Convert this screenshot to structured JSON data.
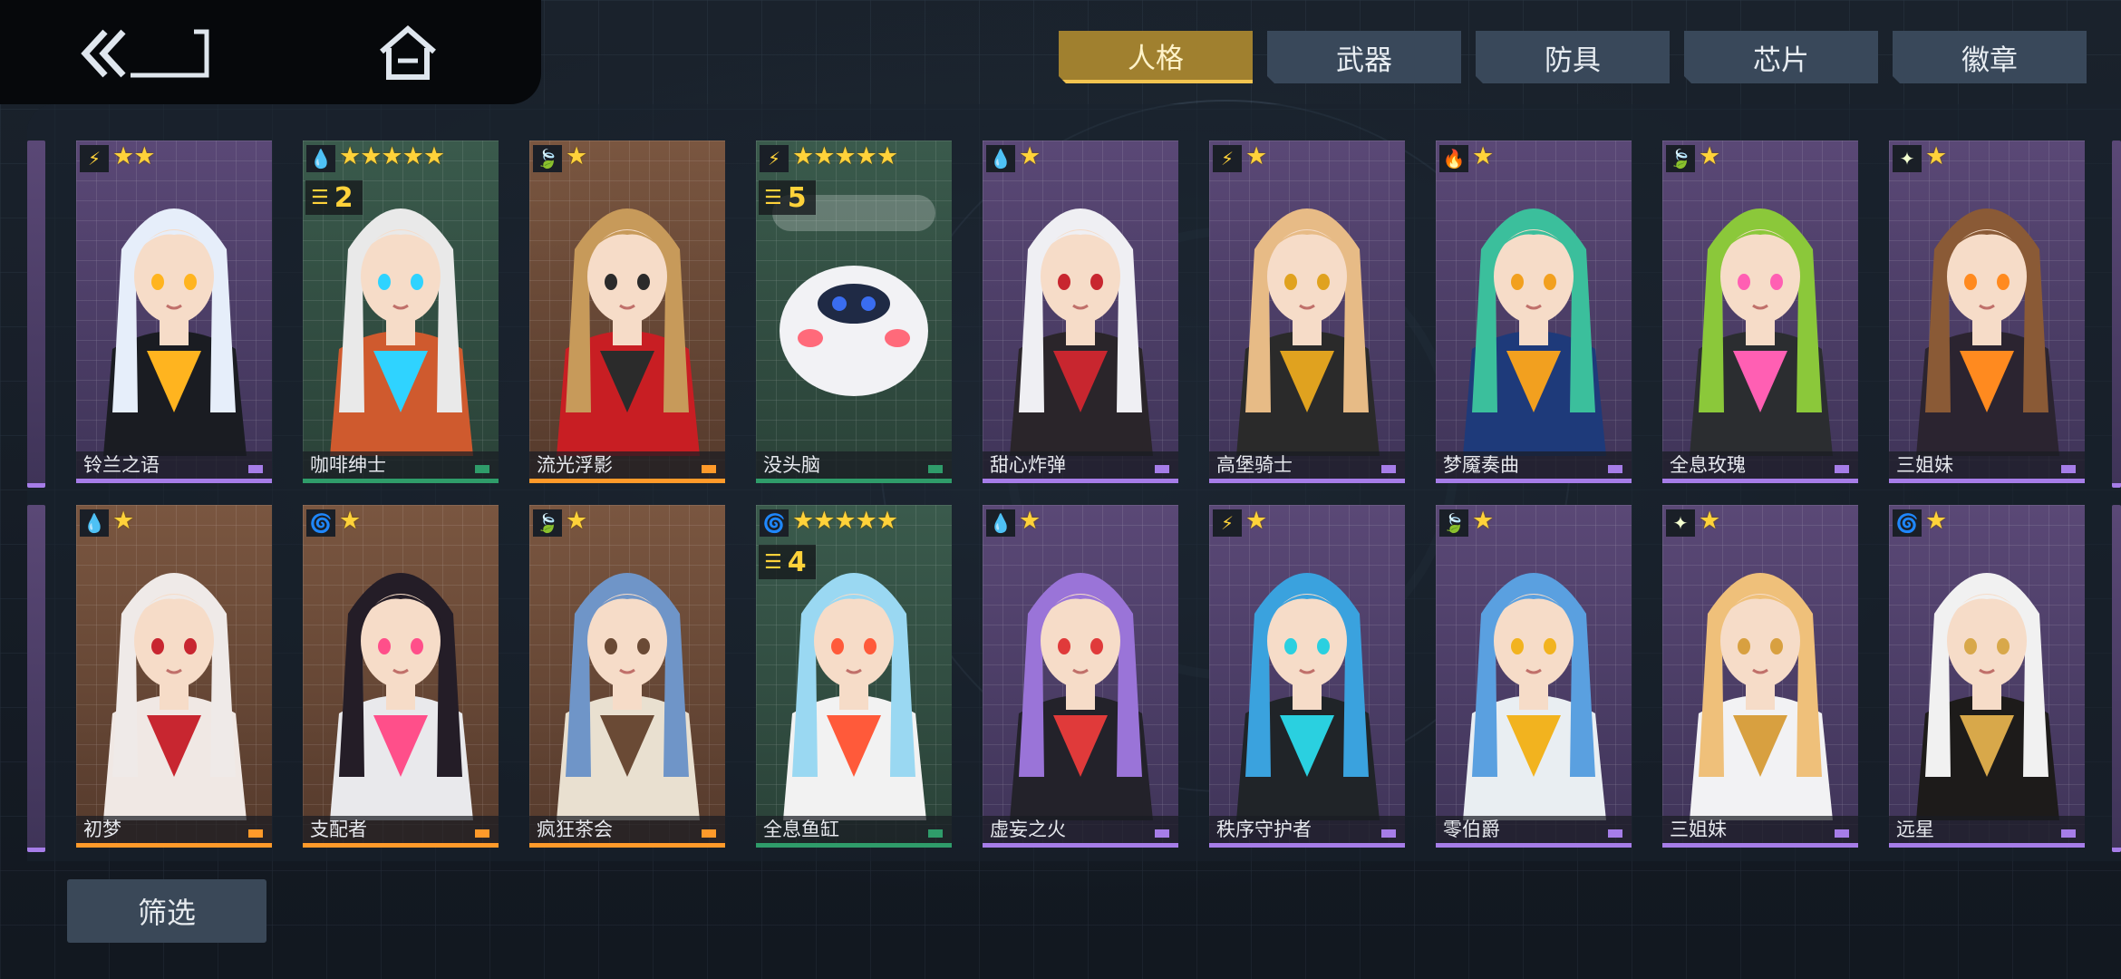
{
  "nav": {
    "back_icon": "double-chevron-back-icon",
    "home_icon": "home-icon"
  },
  "tabs": [
    {
      "label": "人格",
      "active": true
    },
    {
      "label": "武器",
      "active": false
    },
    {
      "label": "防具",
      "active": false
    },
    {
      "label": "芯片",
      "active": false
    },
    {
      "label": "徽章",
      "active": false
    }
  ],
  "element_icons": {
    "electric": {
      "glyph": "⚡",
      "color": "#ffd23a"
    },
    "water": {
      "glyph": "💧",
      "color": "#4fb3ff"
    },
    "wind": {
      "glyph": "🍃",
      "color": "#3cc26a"
    },
    "fire": {
      "glyph": "🔥",
      "color": "#ff5a2a"
    },
    "light": {
      "glyph": "✦",
      "color": "#f3ffd0"
    },
    "vortex": {
      "glyph": "🌀",
      "color": "#c86cff"
    }
  },
  "cards_row1": [
    {
      "name": "铃兰之语",
      "element": "electric",
      "stars": "★★",
      "level": "",
      "rarity": "purple",
      "hair": "#e6eefa",
      "outfit": "#1a1c22",
      "accent": "#ffb41f"
    },
    {
      "name": "咖啡绅士",
      "element": "water",
      "stars": "★★★★★",
      "level": "2",
      "rarity": "green",
      "hair": "#e9e9e9",
      "outfit": "#cf5a2e",
      "accent": "#2fd3ff"
    },
    {
      "name": "流光浮影",
      "element": "wind",
      "stars": "★",
      "level": "",
      "rarity": "orange",
      "hair": "#c79a5a",
      "outfit": "#c81e23",
      "accent": "#2b2b2b"
    },
    {
      "name": "没头脑",
      "element": "electric",
      "stars": "★★★★★",
      "level": "5",
      "rarity": "green",
      "hair": "#f2f2f5",
      "outfit": "#f2f2f5",
      "accent": "#3a6df0"
    },
    {
      "name": "甜心炸弹",
      "element": "water",
      "stars": "★",
      "level": "",
      "rarity": "purple",
      "hair": "#efeff3",
      "outfit": "#2a252a",
      "accent": "#c8262f"
    },
    {
      "name": "高堡骑士",
      "element": "electric",
      "stars": "★",
      "level": "",
      "rarity": "purple",
      "hair": "#e7bb86",
      "outfit": "#2a2a2a",
      "accent": "#e0a21f"
    },
    {
      "name": "梦魇奏曲",
      "element": "fire",
      "stars": "★",
      "level": "",
      "rarity": "purple",
      "hair": "#3bbf9c",
      "outfit": "#1e3a7a",
      "accent": "#f2a01f"
    },
    {
      "name": "全息玫瑰",
      "element": "wind",
      "stars": "★",
      "level": "",
      "rarity": "purple",
      "hair": "#8bc83a",
      "outfit": "#2b2d30",
      "accent": "#ff5fb3"
    },
    {
      "name": "三姐妹",
      "element": "light",
      "stars": "★",
      "level": "",
      "rarity": "purple",
      "hair": "#8a5a36",
      "outfit": "#2b2430",
      "accent": "#ff8a1f"
    }
  ],
  "cards_row2": [
    {
      "name": "初梦",
      "element": "water",
      "stars": "★",
      "level": "",
      "rarity": "orange",
      "hair": "#efeae8",
      "outfit": "#f0e8e4",
      "accent": "#c82630"
    },
    {
      "name": "支配者",
      "element": "vortex",
      "stars": "★",
      "level": "",
      "rarity": "orange",
      "hair": "#241d27",
      "outfit": "#e9e9ec",
      "accent": "#ff4f8a"
    },
    {
      "name": "疯狂茶会",
      "element": "wind",
      "stars": "★",
      "level": "",
      "rarity": "orange",
      "hair": "#6f95c8",
      "outfit": "#e9e0d0",
      "accent": "#6a4a35"
    },
    {
      "name": "全息鱼缸",
      "element": "vortex",
      "stars": "★★★★★",
      "level": "4",
      "rarity": "green",
      "hair": "#9ad8f2",
      "outfit": "#f2f2f2",
      "accent": "#ff5a3a"
    },
    {
      "name": "虚妄之火",
      "element": "water",
      "stars": "★",
      "level": "",
      "rarity": "purple",
      "hair": "#9a74d8",
      "outfit": "#23222a",
      "accent": "#e03a3a"
    },
    {
      "name": "秩序守护者",
      "element": "electric",
      "stars": "★",
      "level": "",
      "rarity": "purple",
      "hair": "#3aa2de",
      "outfit": "#202428",
      "accent": "#2ad0e0"
    },
    {
      "name": "零伯爵",
      "element": "wind",
      "stars": "★",
      "level": "",
      "rarity": "purple",
      "hair": "#5aa0e0",
      "outfit": "#e9eef2",
      "accent": "#f2b31f"
    },
    {
      "name": "三姐妹",
      "element": "light",
      "stars": "★",
      "level": "",
      "rarity": "purple",
      "hair": "#efc07a",
      "outfit": "#f2f2f4",
      "accent": "#d8a040"
    },
    {
      "name": "远星",
      "element": "vortex",
      "stars": "★",
      "level": "",
      "rarity": "purple",
      "hair": "#f1f1f1",
      "outfit": "#1d1b1a",
      "accent": "#d8a84a"
    }
  ],
  "filter": {
    "label": "筛选"
  },
  "colors": {
    "active_tab": "#a0802f",
    "tab": "#39485a",
    "star": "#ffd23a"
  }
}
